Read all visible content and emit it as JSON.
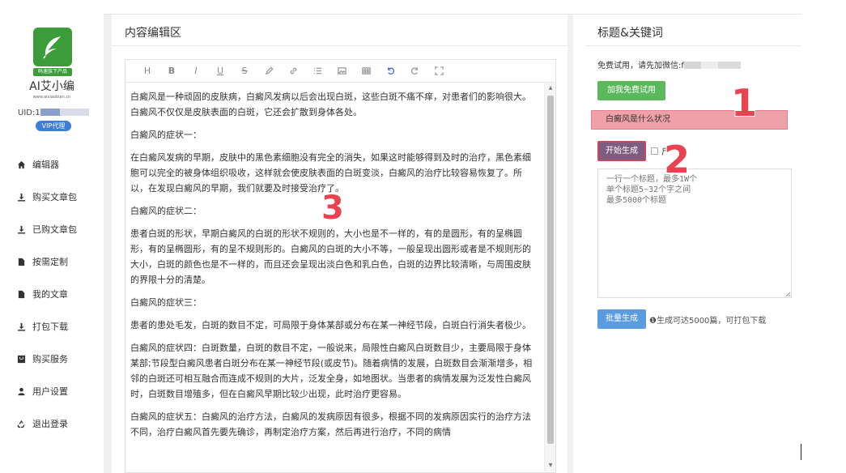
{
  "sidebar": {
    "logo_badge": "码速族下产品",
    "brand": "AI艾小编",
    "site": "www.aixiaobian.cn",
    "uid_label": "UID:1",
    "vip_badge": "VIP代理",
    "items": [
      {
        "label": "编辑器",
        "icon": "home-icon"
      },
      {
        "label": "购买文章包",
        "icon": "download-icon"
      },
      {
        "label": "已购文章包",
        "icon": "download-icon"
      },
      {
        "label": "按需定制",
        "icon": "file-icon"
      },
      {
        "label": "我的文章",
        "icon": "file-icon"
      },
      {
        "label": "打包下载",
        "icon": "download-icon"
      },
      {
        "label": "购买服务",
        "icon": "cart-icon"
      },
      {
        "label": "用户设置",
        "icon": "user-icon"
      },
      {
        "label": "退出登录",
        "icon": "recycle-icon"
      }
    ]
  },
  "editor": {
    "title": "内容编辑区",
    "toolbar": [
      "H",
      "B",
      "I",
      "U",
      "S"
    ],
    "paragraphs": [
      "白癜风是一种顽固的皮肤病，白癜风发病以后会出现白斑，这些白斑不痛不痒，对患者们的影响很大。白癜风不仅仅是皮肤表面的白斑，它还会扩散到身体各处。",
      "白癜风的症状一：",
      "在白癜风发病的早期，皮肤中的黑色素细胞没有完全的消失，如果这时能够得到及时的治疗，黑色素细胞可以完全的被身体组织吸收，这样就会使皮肤表面的白斑变淡，白癜风的治疗比较容易恢复了。所以，在发现白癜风的早期，我们就要及时接受治疗了。",
      "白癜风的症状二：",
      "患者白斑的形状，早期白癜风的白斑的形状不规则的，大小也是不一样的，有的是圆形，有的呈椭圆形，有的呈椭圆形，有的呈不规则形的。白癜风的白斑的大小不等，一般呈现出圆形或者是不规则形的大小，白斑的颜色也是不一样的，而且还会呈现出淡白色和乳白色，白斑的边界比较清晰，与周围皮肤的界限十分的清楚。",
      "白癜风的症状三：",
      "患者的患处毛发，白斑的数目不定，可局限于身体某部或分布在某一神经节段，白斑白行消失者极少。",
      "白癜风的症状四：白斑数量，白斑的数目不定，一般说来，局限性白癜风白斑数目少，主要局限于身体某部;节段型白癜风患者白斑分布在某一神经节段(或皮节)。随着病情的发展，白斑数目会渐渐增多，相邻的白斑还可相互融合而连成不规则的大片，泛发全身，如地图状。当患者的病情发展为泛发性白癜风时，白斑数目增殖多，但在白癜风早期比较少出现，此时治疗更容易。",
      "白癜风的症状五：白癜风的治疗方法，白癜风的发病原因有很多，根据不同的发病原因实行的治疗方法不同，治疗白癜风首先要先确诊，再制定治疗方案，然后再进行治疗，不同的病情"
    ]
  },
  "right": {
    "title": "标题&关键词",
    "free_text": "免费试用，请先加微信:f",
    "add_button": "加我免费试用",
    "keyword_value": "白癜风是什么状况",
    "generate_button": "开始生成",
    "generate_option": "尸",
    "titles_placeholder": "一行一个标题，最多1W个\n单个标题5~32个字之间\n最多5000个标题",
    "batch_button": "批量生成",
    "batch_note": "❶生成可达5000篇，可打包下载"
  },
  "annotations": [
    "1",
    "2",
    "3"
  ],
  "colors": {
    "green": "#5cb85c",
    "logo_green": "#3d9c3a",
    "blue": "#5b9be0",
    "vip_blue": "#3d7ed8",
    "highlight_red": "#f0a0a8",
    "annotation_red": "#e8434f"
  }
}
